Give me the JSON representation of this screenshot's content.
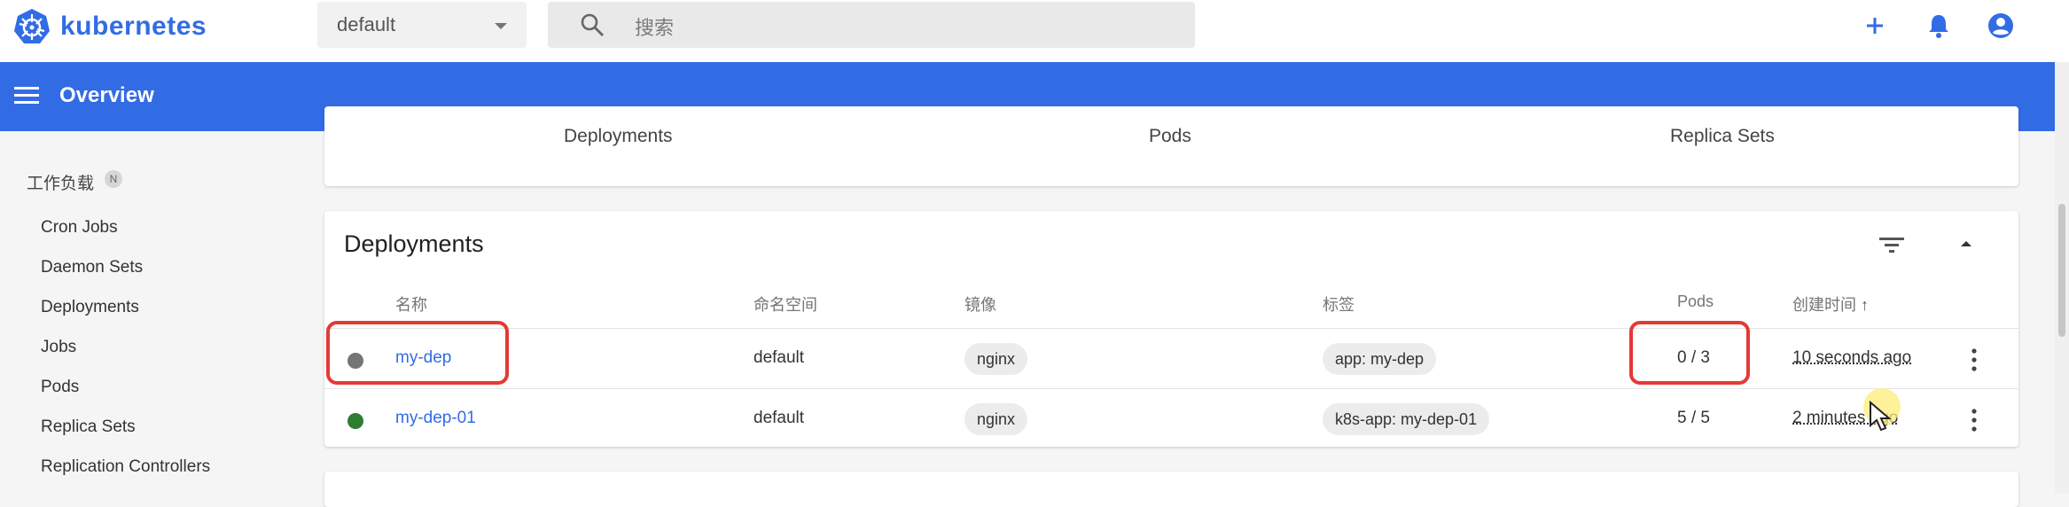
{
  "app": {
    "brand": "kubernetes"
  },
  "namespace": {
    "selected": "default"
  },
  "search": {
    "placeholder": "搜索"
  },
  "toolbar": {
    "title": "Overview"
  },
  "sidebar": {
    "section": "工作负载",
    "section_badge": "N",
    "items": [
      {
        "label": "Cron Jobs"
      },
      {
        "label": "Daemon Sets"
      },
      {
        "label": "Deployments"
      },
      {
        "label": "Jobs"
      },
      {
        "label": "Pods"
      },
      {
        "label": "Replica Sets"
      },
      {
        "label": "Replication Controllers"
      }
    ]
  },
  "summary": {
    "labels": [
      "Deployments",
      "Pods",
      "Replica Sets"
    ]
  },
  "deployments": {
    "title": "Deployments",
    "columns": {
      "name": "名称",
      "namespace": "命名空间",
      "image": "镜像",
      "labels": "标签",
      "pods": "Pods",
      "created": "创建时间",
      "sort_indicator": "↑"
    },
    "rows": [
      {
        "status": "pending",
        "status_color": "#757575",
        "name": "my-dep",
        "namespace": "default",
        "image": "nginx",
        "label": "app: my-dep",
        "pods": "0 / 3",
        "created": "10 seconds ago"
      },
      {
        "status": "running",
        "status_color": "#2e7d32",
        "name": "my-dep-01",
        "namespace": "default",
        "image": "nginx",
        "label": "k8s-app: my-dep-01",
        "pods": "5 / 5",
        "created": "2 minutes ago"
      }
    ]
  },
  "colors": {
    "accent": "#326ce5",
    "highlight": "#e53935"
  },
  "icons": [
    "kubernetes-logo",
    "chevron-down-icon",
    "search-icon",
    "add-icon",
    "bell-icon",
    "account-icon",
    "menu-icon",
    "filter-icon",
    "collapse-icon",
    "more-vert-icon",
    "cursor-icon"
  ]
}
